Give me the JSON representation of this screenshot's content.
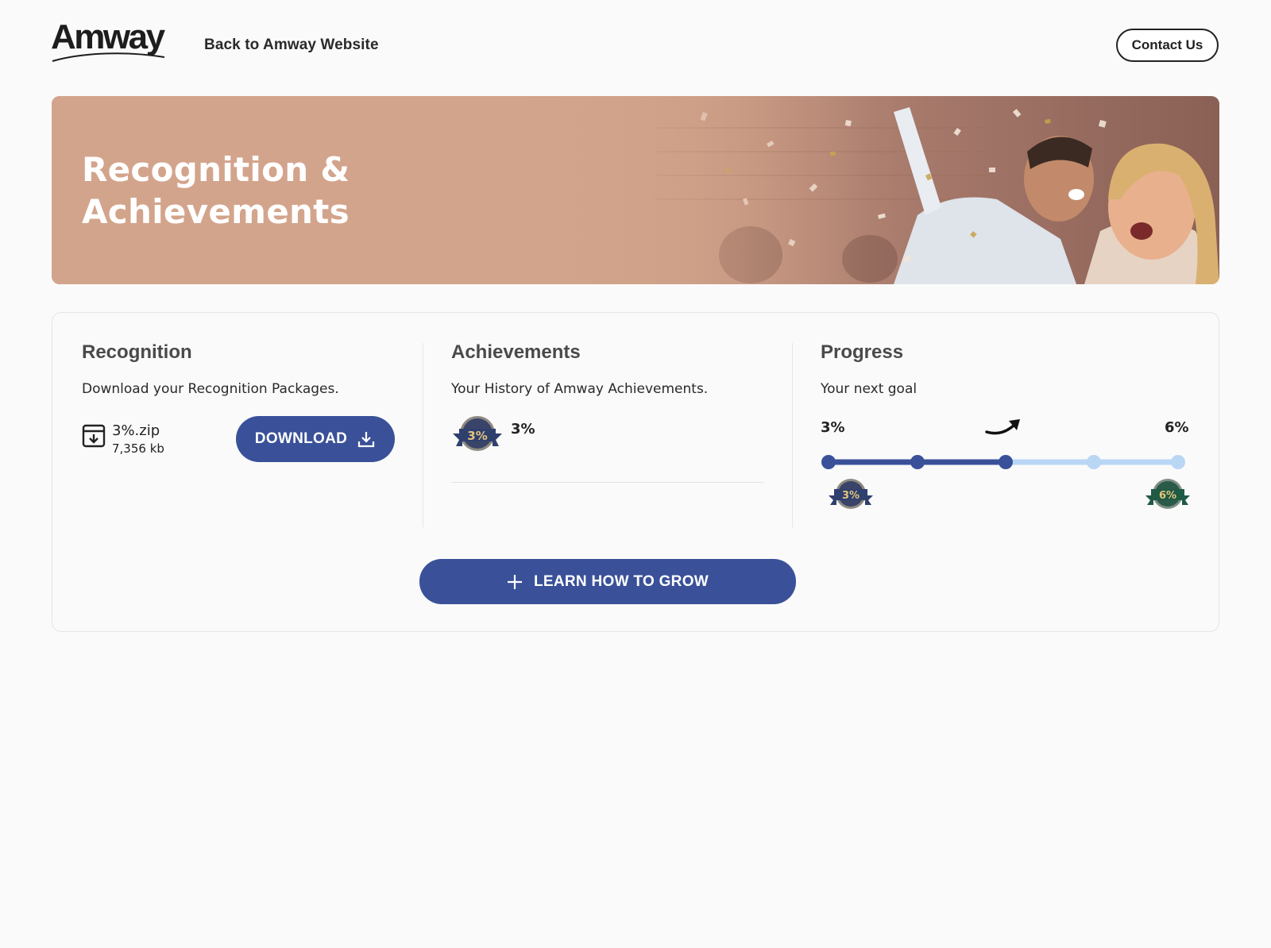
{
  "header": {
    "logo_text": "Amway",
    "back_link": "Back to Amway Website",
    "contact_button": "Contact Us"
  },
  "hero": {
    "title": "Recognition &\nAchievements"
  },
  "recognition": {
    "title": "Recognition",
    "subtitle": "Download your Recognition Packages.",
    "file_name": "3%.zip",
    "file_size": "7,356 kb",
    "download_button": "DOWNLOAD",
    "icon": "archive-download-icon"
  },
  "achievements": {
    "title": "Achievements",
    "subtitle": "Your History of Amway Achievements.",
    "items": [
      {
        "badge_text": "3%",
        "label": "3%"
      }
    ]
  },
  "progress": {
    "title": "Progress",
    "subtitle": "Your next goal",
    "start_label": "3%",
    "end_label": "6%",
    "start_badge": "3%",
    "end_badge": "6%",
    "steps_total": 5,
    "steps_completed": 3
  },
  "actions": {
    "grow_button": "LEARN HOW TO GROW"
  },
  "colors": {
    "primary": "#3a5199",
    "track_inactive": "#b9d6f5",
    "hero_bg": "#d3a48c",
    "badge_blue": "#2f3f6e",
    "badge_green": "#1f5a45",
    "badge_gold": "#e3c57a"
  }
}
